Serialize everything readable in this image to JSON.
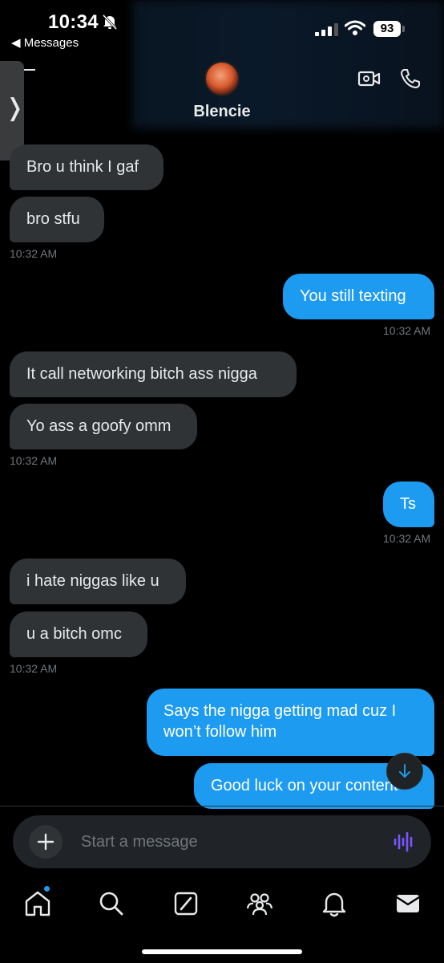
{
  "status_bar": {
    "time": "10:34",
    "back_app": "◀ Messages",
    "battery": "93"
  },
  "header": {
    "contact_name": "Blencie",
    "side_tab_glyph": "❭"
  },
  "messages": [
    {
      "dir": "in",
      "text": "Bro u think I gaf"
    },
    {
      "dir": "in",
      "text": "bro stfu"
    },
    {
      "time": "10:32 AM"
    },
    {
      "dir": "out",
      "text": "You still texting"
    },
    {
      "time": "10:32 AM"
    },
    {
      "dir": "in",
      "text": "It call networking bitch ass nigga"
    },
    {
      "dir": "in",
      "text": "Yo ass a goofy omm"
    },
    {
      "time": "10:32 AM"
    },
    {
      "dir": "out",
      "text": "Ts"
    },
    {
      "time": "10:32 AM"
    },
    {
      "dir": "in",
      "text": "i hate niggas like u"
    },
    {
      "dir": "in",
      "text": "u a bitch omc"
    },
    {
      "time": "10:32 AM"
    },
    {
      "dir": "out",
      "text": "Says the nigga getting mad cuz I won’t follow him"
    },
    {
      "dir": "out",
      "text": "Good luck on your content"
    }
  ],
  "composer": {
    "placeholder": "Start a message"
  },
  "icons": {
    "status": [
      "bell-off-icon",
      "signal-icon",
      "wifi-icon",
      "battery-icon"
    ],
    "header": [
      "back-icon",
      "video-call-icon",
      "phone-icon"
    ],
    "composer": [
      "plus-icon",
      "voice-message-icon"
    ],
    "tabbar": [
      "home-icon",
      "search-icon",
      "grok-icon",
      "communities-icon",
      "notifications-icon",
      "messages-icon"
    ]
  },
  "colors": {
    "accent": "#1d9bf0",
    "incoming_bubble": "#2f3336",
    "voice_icon": "#7856ff"
  }
}
